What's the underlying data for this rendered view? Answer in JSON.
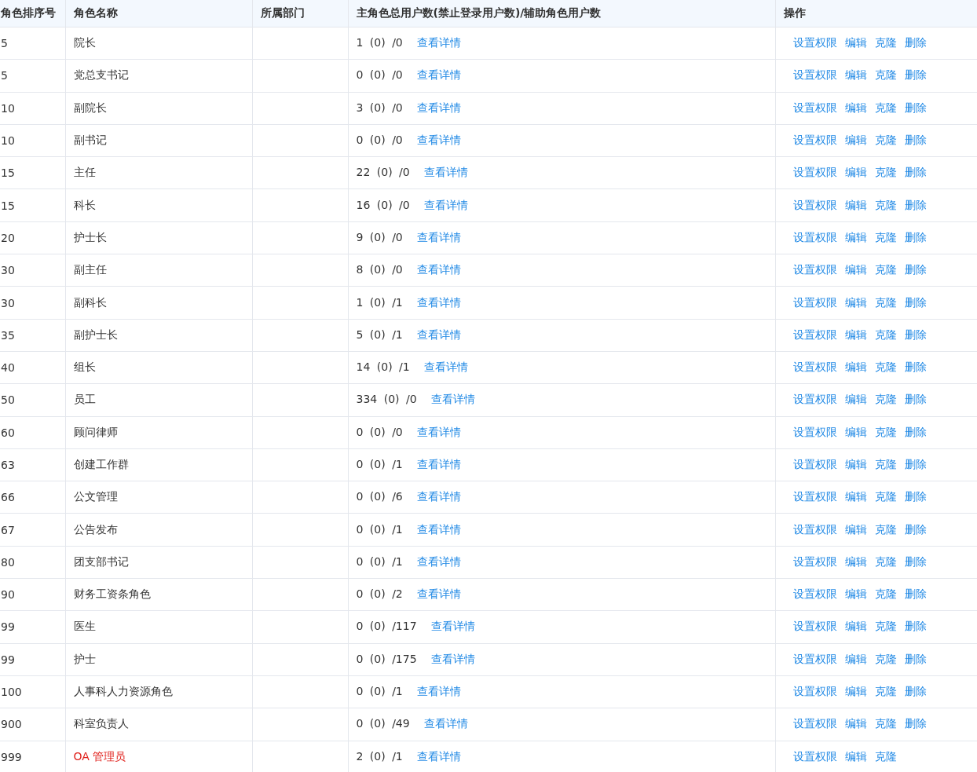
{
  "table": {
    "columns": [
      "角色排序号",
      "角色名称",
      "所属部门",
      "主角色总用户数(禁止登录用户数)/辅助角色用户数",
      "操作"
    ],
    "rows": [
      {
        "order": "5",
        "name": "院长",
        "builtin": false,
        "counts": "1 (0) /0",
        "detail": "查看详情",
        "actions": [
          "设置权限",
          "编辑",
          "克隆",
          "删除"
        ]
      },
      {
        "order": "5",
        "name": "党总支书记",
        "builtin": false,
        "counts": "0 (0) /0",
        "detail": "查看详情",
        "actions": [
          "设置权限",
          "编辑",
          "克隆",
          "删除"
        ]
      },
      {
        "order": "10",
        "name": "副院长",
        "builtin": false,
        "counts": "3 (0) /0",
        "detail": "查看详情",
        "actions": [
          "设置权限",
          "编辑",
          "克隆",
          "删除"
        ]
      },
      {
        "order": "10",
        "name": "副书记",
        "builtin": false,
        "counts": "0 (0) /0",
        "detail": "查看详情",
        "actions": [
          "设置权限",
          "编辑",
          "克隆",
          "删除"
        ]
      },
      {
        "order": "15",
        "name": "主任",
        "builtin": false,
        "counts": "22 (0) /0",
        "detail": "查看详情",
        "actions": [
          "设置权限",
          "编辑",
          "克隆",
          "删除"
        ]
      },
      {
        "order": "15",
        "name": "科长",
        "builtin": false,
        "counts": "16 (0) /0",
        "detail": "查看详情",
        "actions": [
          "设置权限",
          "编辑",
          "克隆",
          "删除"
        ]
      },
      {
        "order": "20",
        "name": "护士长",
        "builtin": false,
        "counts": "9 (0) /0",
        "detail": "查看详情",
        "actions": [
          "设置权限",
          "编辑",
          "克隆",
          "删除"
        ]
      },
      {
        "order": "30",
        "name": "副主任",
        "builtin": false,
        "counts": "8 (0) /0",
        "detail": "查看详情",
        "actions": [
          "设置权限",
          "编辑",
          "克隆",
          "删除"
        ]
      },
      {
        "order": "30",
        "name": "副科长",
        "builtin": false,
        "counts": "1 (0) /1",
        "detail": "查看详情",
        "actions": [
          "设置权限",
          "编辑",
          "克隆",
          "删除"
        ]
      },
      {
        "order": "35",
        "name": "副护士长",
        "builtin": false,
        "counts": "5 (0) /1",
        "detail": "查看详情",
        "actions": [
          "设置权限",
          "编辑",
          "克隆",
          "删除"
        ]
      },
      {
        "order": "40",
        "name": "组长",
        "builtin": false,
        "counts": "14 (0) /1",
        "detail": "查看详情",
        "actions": [
          "设置权限",
          "编辑",
          "克隆",
          "删除"
        ]
      },
      {
        "order": "50",
        "name": "员工",
        "builtin": false,
        "counts": "334 (0) /0",
        "detail": "查看详情",
        "actions": [
          "设置权限",
          "编辑",
          "克隆",
          "删除"
        ]
      },
      {
        "order": "60",
        "name": "顾问律师",
        "builtin": false,
        "counts": "0 (0) /0",
        "detail": "查看详情",
        "actions": [
          "设置权限",
          "编辑",
          "克隆",
          "删除"
        ]
      },
      {
        "order": "63",
        "name": "创建工作群",
        "builtin": false,
        "counts": "0 (0) /1",
        "detail": "查看详情",
        "actions": [
          "设置权限",
          "编辑",
          "克隆",
          "删除"
        ]
      },
      {
        "order": "66",
        "name": "公文管理",
        "builtin": false,
        "counts": "0 (0) /6",
        "detail": "查看详情",
        "actions": [
          "设置权限",
          "编辑",
          "克隆",
          "删除"
        ]
      },
      {
        "order": "67",
        "name": "公告发布",
        "builtin": false,
        "counts": "0 (0) /1",
        "detail": "查看详情",
        "actions": [
          "设置权限",
          "编辑",
          "克隆",
          "删除"
        ]
      },
      {
        "order": "80",
        "name": "团支部书记",
        "builtin": false,
        "counts": "0 (0) /1",
        "detail": "查看详情",
        "actions": [
          "设置权限",
          "编辑",
          "克隆",
          "删除"
        ]
      },
      {
        "order": "90",
        "name": "财务工资条角色",
        "builtin": false,
        "counts": "0 (0) /2",
        "detail": "查看详情",
        "actions": [
          "设置权限",
          "编辑",
          "克隆",
          "删除"
        ]
      },
      {
        "order": "99",
        "name": "医生",
        "builtin": false,
        "counts": "0 (0) /117",
        "detail": "查看详情",
        "actions": [
          "设置权限",
          "编辑",
          "克隆",
          "删除"
        ]
      },
      {
        "order": "99",
        "name": "护士",
        "builtin": false,
        "counts": "0 (0) /175",
        "detail": "查看详情",
        "actions": [
          "设置权限",
          "编辑",
          "克隆",
          "删除"
        ]
      },
      {
        "order": "100",
        "name": "人事科人力资源角色",
        "builtin": false,
        "counts": "0 (0) /1",
        "detail": "查看详情",
        "actions": [
          "设置权限",
          "编辑",
          "克隆",
          "删除"
        ]
      },
      {
        "order": "900",
        "name": "科室负责人",
        "builtin": false,
        "counts": "0 (0) /49",
        "detail": "查看详情",
        "actions": [
          "设置权限",
          "编辑",
          "克隆",
          "删除"
        ]
      },
      {
        "order": "999",
        "name": "OA 管理员",
        "builtin": true,
        "counts": "2 (0) /1",
        "detail": "查看详情",
        "actions": [
          "设置权限",
          "编辑",
          "克隆"
        ]
      }
    ]
  }
}
